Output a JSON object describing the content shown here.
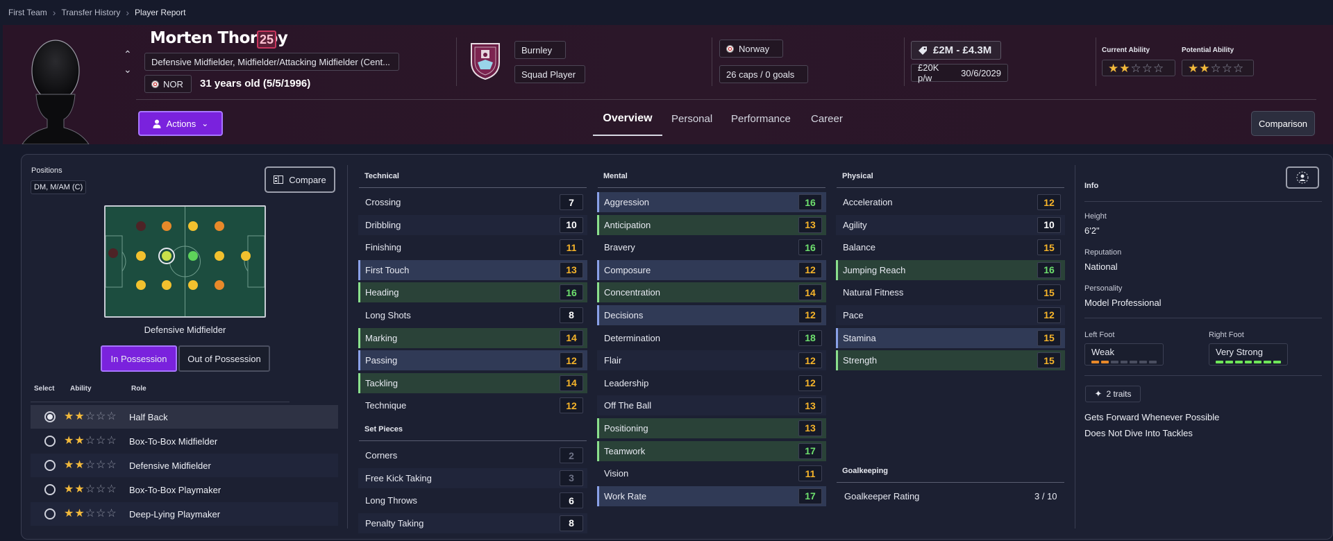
{
  "breadcrumb": [
    "First Team",
    "Transfer History",
    "Player Report"
  ],
  "player": {
    "name": "Morten Thorsby",
    "number": "25",
    "positions": "Defensive Midfielder, Midfielder/Attacking Midfielder (Cent...",
    "nationality_code": "NOR",
    "age_text": "31 years old (5/5/1996)"
  },
  "club": {
    "name": "Burnley",
    "status": "Squad Player"
  },
  "country": {
    "name": "Norway",
    "caps": "26 caps / 0 goals"
  },
  "contract": {
    "value": "£2M - £4.3M",
    "wage": "£20K p/w",
    "expires": "30/6/2029"
  },
  "ability": {
    "current_label": "Current Ability",
    "potential_label": "Potential Ability",
    "current_stars": 2,
    "potential_stars": 2,
    "max_stars": 5
  },
  "buttons": {
    "actions": "Actions",
    "comparison": "Comparison",
    "compare": "Compare",
    "in_possession": "In Possession",
    "out_of_possession": "Out of Possession"
  },
  "tabs": [
    "Overview",
    "Personal",
    "Performance",
    "Career"
  ],
  "positions_panel": {
    "label": "Positions",
    "short": "DM, M/AM (C)",
    "role_label": "Defensive Midfielder",
    "table_headers": {
      "select": "Select",
      "ability": "Ability",
      "role": "Role"
    },
    "roles": [
      {
        "name": "Half Back",
        "stars": 2,
        "selected": true
      },
      {
        "name": "Box-To-Box Midfielder",
        "stars": 2,
        "selected": false
      },
      {
        "name": "Defensive Midfielder",
        "stars": 2,
        "selected": false
      },
      {
        "name": "Box-To-Box Playmaker",
        "stars": 2,
        "selected": false
      },
      {
        "name": "Deep-Lying Playmaker",
        "stars": 2,
        "selected": false
      }
    ],
    "pitch_colors": {
      "natural": "#c8e04a",
      "accomplished": "#f2c12e",
      "competent": "#e8892a",
      "unconvincing": "#4d2326",
      "selected_ring": "#c8e04a",
      "green": "#5ed35a"
    }
  },
  "technical": {
    "title": "Technical",
    "attrs": [
      {
        "name": "Crossing",
        "value": "7",
        "hl": "",
        "tone": "w"
      },
      {
        "name": "Dribbling",
        "value": "10",
        "hl": "alt",
        "tone": "w"
      },
      {
        "name": "Finishing",
        "value": "11",
        "hl": "",
        "tone": "y"
      },
      {
        "name": "First Touch",
        "value": "13",
        "hl": "b",
        "tone": "y"
      },
      {
        "name": "Heading",
        "value": "16",
        "hl": "g",
        "tone": "g"
      },
      {
        "name": "Long Shots",
        "value": "8",
        "hl": "",
        "tone": "w"
      },
      {
        "name": "Marking",
        "value": "14",
        "hl": "g",
        "tone": "y"
      },
      {
        "name": "Passing",
        "value": "12",
        "hl": "b",
        "tone": "y"
      },
      {
        "name": "Tackling",
        "value": "14",
        "hl": "g",
        "tone": "y"
      },
      {
        "name": "Technique",
        "value": "12",
        "hl": "",
        "tone": "y"
      }
    ]
  },
  "set_pieces": {
    "title": "Set Pieces",
    "attrs": [
      {
        "name": "Corners",
        "value": "2",
        "hl": "",
        "tone": "d"
      },
      {
        "name": "Free Kick Taking",
        "value": "3",
        "hl": "alt",
        "tone": "d"
      },
      {
        "name": "Long Throws",
        "value": "6",
        "hl": "",
        "tone": "w"
      },
      {
        "name": "Penalty Taking",
        "value": "8",
        "hl": "alt",
        "tone": "w"
      }
    ]
  },
  "mental": {
    "title": "Mental",
    "attrs": [
      {
        "name": "Aggression",
        "value": "16",
        "hl": "b",
        "tone": "g"
      },
      {
        "name": "Anticipation",
        "value": "13",
        "hl": "g",
        "tone": "y"
      },
      {
        "name": "Bravery",
        "value": "16",
        "hl": "",
        "tone": "g"
      },
      {
        "name": "Composure",
        "value": "12",
        "hl": "b",
        "tone": "y"
      },
      {
        "name": "Concentration",
        "value": "14",
        "hl": "g",
        "tone": "y"
      },
      {
        "name": "Decisions",
        "value": "12",
        "hl": "b",
        "tone": "y"
      },
      {
        "name": "Determination",
        "value": "18",
        "hl": "",
        "tone": "g"
      },
      {
        "name": "Flair",
        "value": "12",
        "hl": "alt",
        "tone": "y"
      },
      {
        "name": "Leadership",
        "value": "12",
        "hl": "",
        "tone": "y"
      },
      {
        "name": "Off The Ball",
        "value": "13",
        "hl": "alt",
        "tone": "y"
      },
      {
        "name": "Positioning",
        "value": "13",
        "hl": "g",
        "tone": "y"
      },
      {
        "name": "Teamwork",
        "value": "17",
        "hl": "g",
        "tone": "g"
      },
      {
        "name": "Vision",
        "value": "11",
        "hl": "",
        "tone": "y"
      },
      {
        "name": "Work Rate",
        "value": "17",
        "hl": "b",
        "tone": "g"
      }
    ]
  },
  "physical": {
    "title": "Physical",
    "attrs": [
      {
        "name": "Acceleration",
        "value": "12",
        "hl": "",
        "tone": "y"
      },
      {
        "name": "Agility",
        "value": "10",
        "hl": "alt",
        "tone": "w"
      },
      {
        "name": "Balance",
        "value": "15",
        "hl": "",
        "tone": "y"
      },
      {
        "name": "Jumping Reach",
        "value": "16",
        "hl": "g",
        "tone": "g"
      },
      {
        "name": "Natural Fitness",
        "value": "15",
        "hl": "",
        "tone": "y"
      },
      {
        "name": "Pace",
        "value": "12",
        "hl": "alt",
        "tone": "y"
      },
      {
        "name": "Stamina",
        "value": "15",
        "hl": "b",
        "tone": "y"
      },
      {
        "name": "Strength",
        "value": "15",
        "hl": "g",
        "tone": "y"
      }
    ]
  },
  "goalkeeping": {
    "title": "Goalkeeping",
    "label": "Goalkeeper Rating",
    "value": "3 / 10"
  },
  "info": {
    "title": "Info",
    "height_label": "Height",
    "height": "6'2\"",
    "reputation_label": "Reputation",
    "reputation": "National",
    "personality_label": "Personality",
    "personality": "Model Professional",
    "left_foot_label": "Left Foot",
    "left_foot": "Weak",
    "left_foot_level": 2,
    "right_foot_label": "Right Foot",
    "right_foot": "Very Strong",
    "right_foot_level": 7,
    "traits_count": "2 traits",
    "traits": [
      "Gets Forward Whenever Possible",
      "Does Not Dive Into Tackles"
    ]
  },
  "colors": {
    "accent": "#7a22dd",
    "yellow": "#f6b42a",
    "green": "#6ee06e",
    "orange": "#e8892a",
    "header_bg": "#2b1729"
  }
}
